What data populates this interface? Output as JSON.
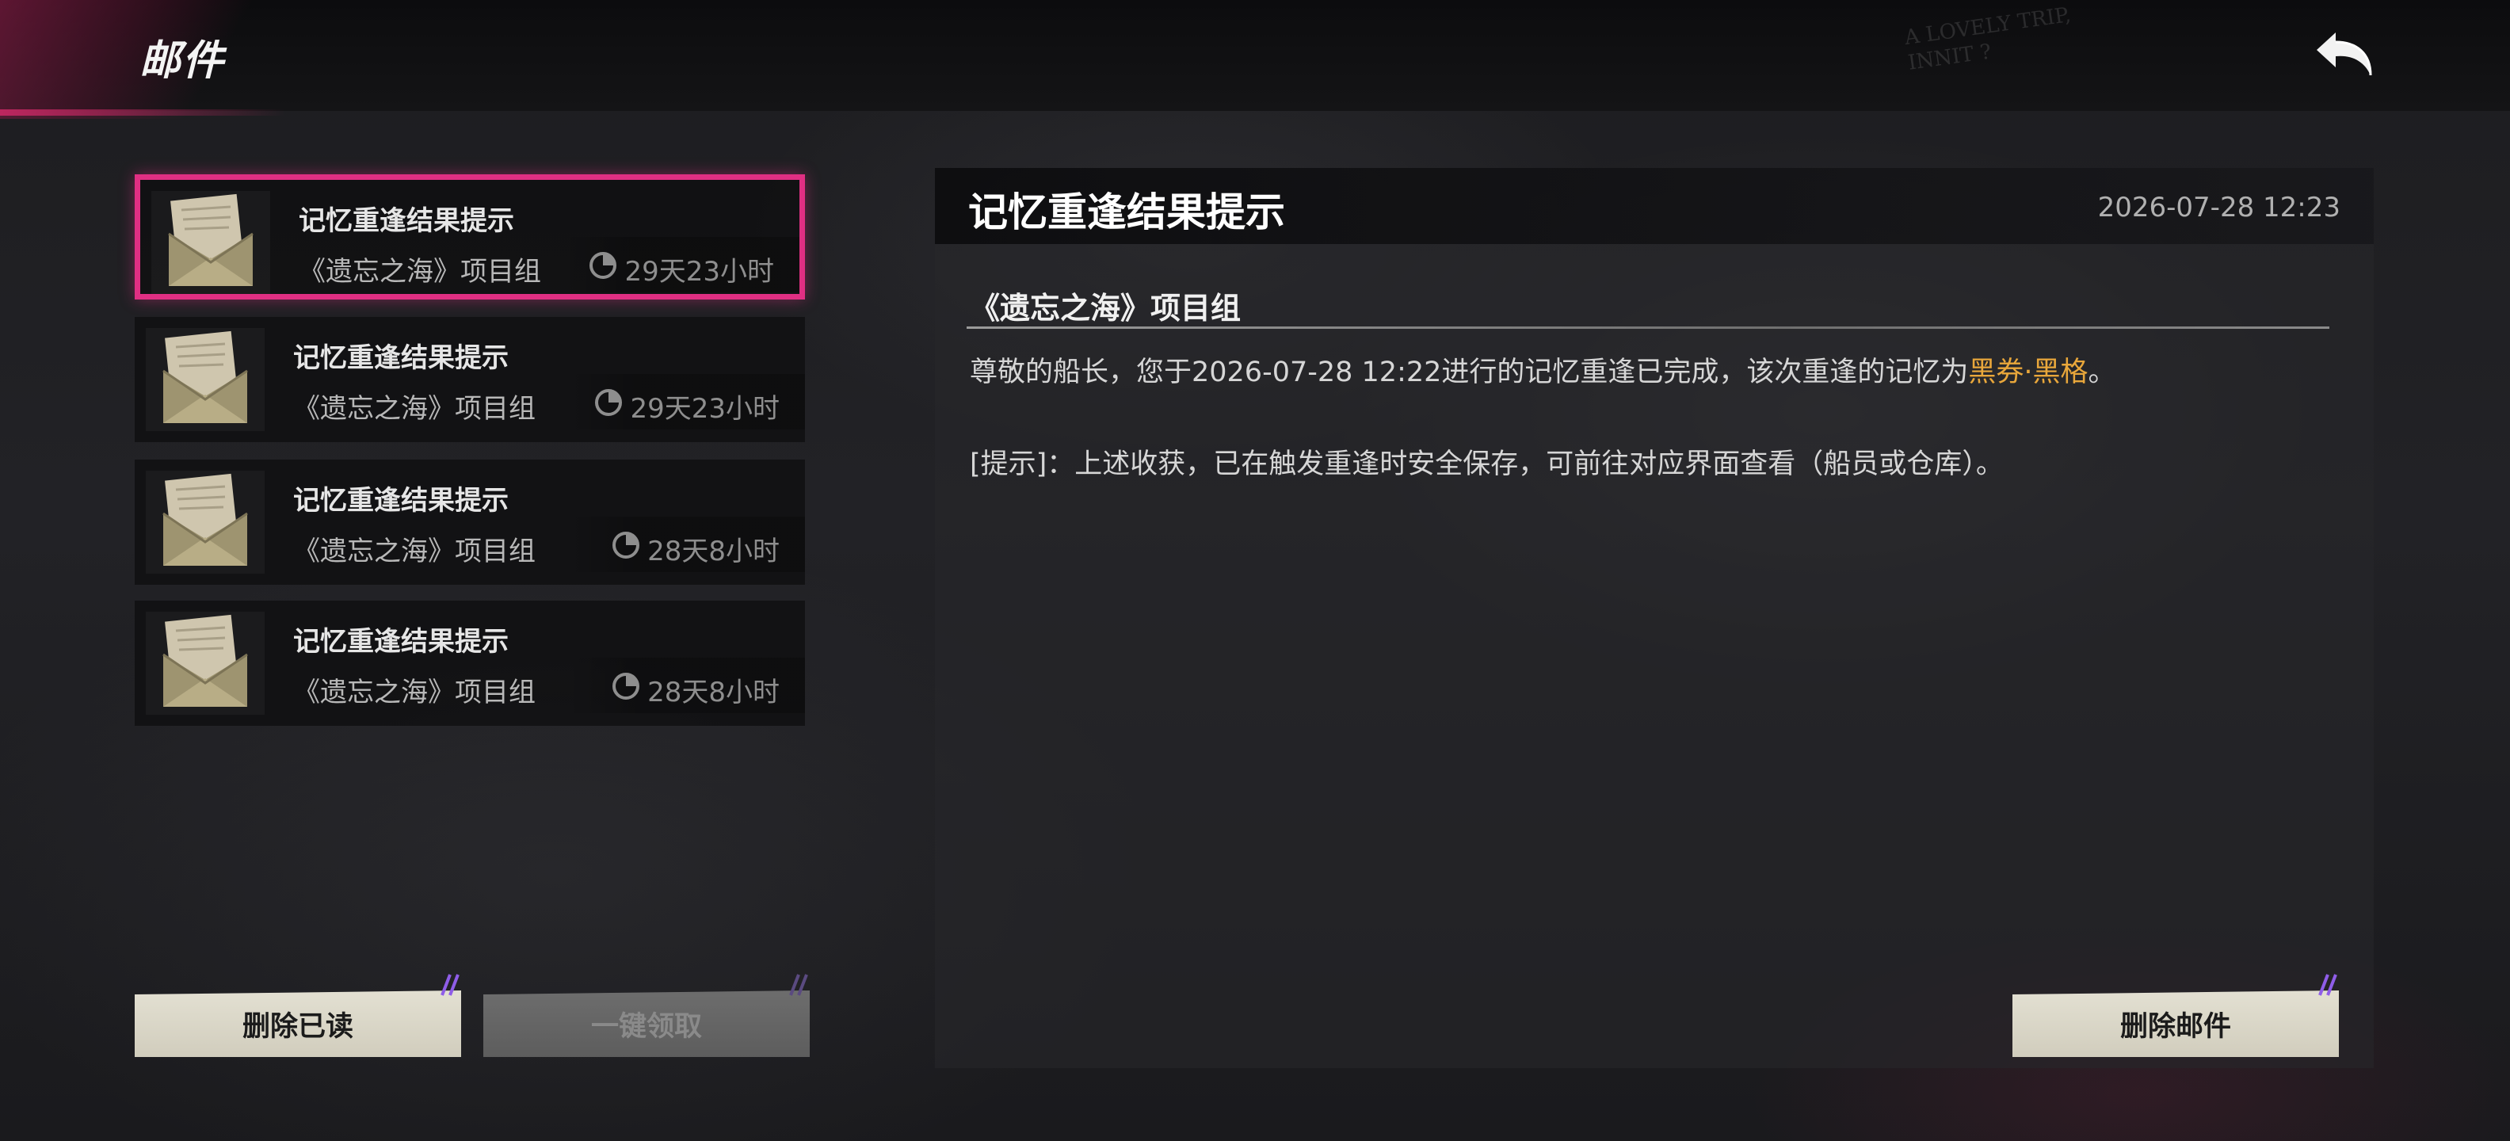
{
  "header": {
    "title": "邮件",
    "deco_text": "A LOVELY TRIP, INNIT ?"
  },
  "mail_list": [
    {
      "subject": "记忆重逢结果提示",
      "sender": "《遗忘之海》项目组",
      "expiry": "29天23小时",
      "selected": true
    },
    {
      "subject": "记忆重逢结果提示",
      "sender": "《遗忘之海》项目组",
      "expiry": "29天23小时",
      "selected": false
    },
    {
      "subject": "记忆重逢结果提示",
      "sender": "《遗忘之海》项目组",
      "expiry": "28天8小时",
      "selected": false
    },
    {
      "subject": "记忆重逢结果提示",
      "sender": "《遗忘之海》项目组",
      "expiry": "28天8小时",
      "selected": false
    }
  ],
  "list_buttons": {
    "delete_read": "删除已读",
    "claim_all": "一键领取"
  },
  "detail": {
    "title": "记忆重逢结果提示",
    "datetime": "2026-07-28 12:23",
    "sender": "《遗忘之海》项目组",
    "body_line1_prefix": "尊敬的船长，您于2026-07-28 12:22进行的记忆重逢已完成，该次重逢的记忆为",
    "body_line1_highlight": "黑券·黑格",
    "body_line1_suffix": "。",
    "body_line2": "[提示]：上述收获，已在触发重逢时安全保存，可前往对应界面查看（船员或仓库）。",
    "delete_button": "删除邮件"
  },
  "colors": {
    "selection": "#e02f83",
    "highlight": "#e9a73b",
    "button_bg": "#dcd9ca"
  },
  "icons": [
    "back-arrow-icon",
    "envelope-icon",
    "clock-icon"
  ]
}
